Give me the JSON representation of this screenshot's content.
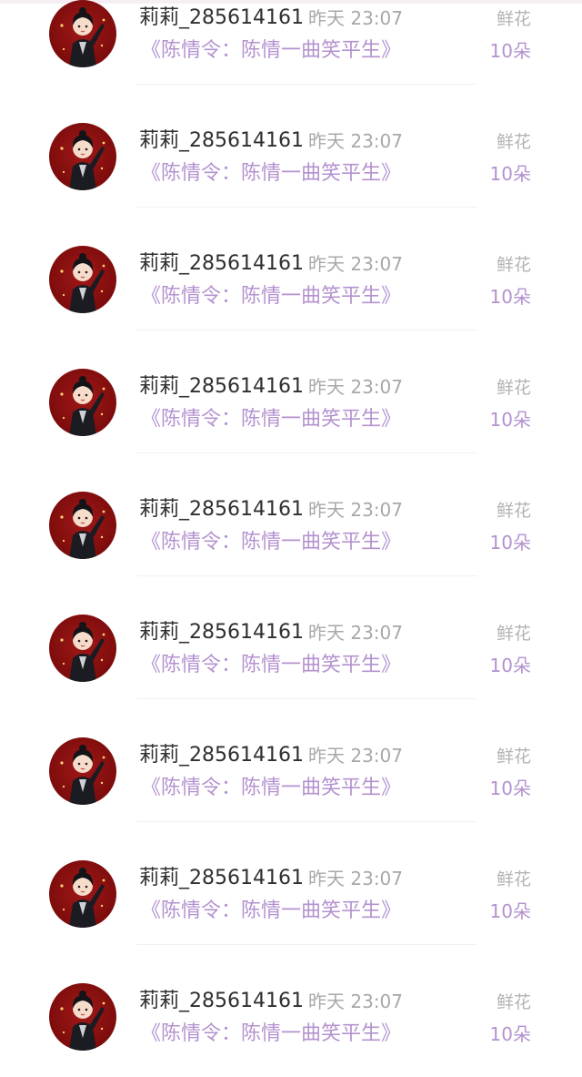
{
  "gift_list": {
    "items": [
      {
        "user": "莉莉_285614161",
        "time": "昨天 23:07",
        "book": "《陈情令：陈情一曲笑平生》",
        "gift_type": "鲜花",
        "gift_count": "10朵",
        "avatar_icon": "user-avatar-icon"
      },
      {
        "user": "莉莉_285614161",
        "time": "昨天 23:07",
        "book": "《陈情令：陈情一曲笑平生》",
        "gift_type": "鲜花",
        "gift_count": "10朵",
        "avatar_icon": "user-avatar-icon"
      },
      {
        "user": "莉莉_285614161",
        "time": "昨天 23:07",
        "book": "《陈情令：陈情一曲笑平生》",
        "gift_type": "鲜花",
        "gift_count": "10朵",
        "avatar_icon": "user-avatar-icon"
      },
      {
        "user": "莉莉_285614161",
        "time": "昨天 23:07",
        "book": "《陈情令：陈情一曲笑平生》",
        "gift_type": "鲜花",
        "gift_count": "10朵",
        "avatar_icon": "user-avatar-icon"
      },
      {
        "user": "莉莉_285614161",
        "time": "昨天 23:07",
        "book": "《陈情令：陈情一曲笑平生》",
        "gift_type": "鲜花",
        "gift_count": "10朵",
        "avatar_icon": "user-avatar-icon"
      },
      {
        "user": "莉莉_285614161",
        "time": "昨天 23:07",
        "book": "《陈情令：陈情一曲笑平生》",
        "gift_type": "鲜花",
        "gift_count": "10朵",
        "avatar_icon": "user-avatar-icon"
      },
      {
        "user": "莉莉_285614161",
        "time": "昨天 23:07",
        "book": "《陈情令：陈情一曲笑平生》",
        "gift_type": "鲜花",
        "gift_count": "10朵",
        "avatar_icon": "user-avatar-icon"
      },
      {
        "user": "莉莉_285614161",
        "time": "昨天 23:07",
        "book": "《陈情令：陈情一曲笑平生》",
        "gift_type": "鲜花",
        "gift_count": "10朵",
        "avatar_icon": "user-avatar-icon"
      },
      {
        "user": "莉莉_285614161",
        "time": "昨天 23:07",
        "book": "《陈情令：陈情一曲笑平生》",
        "gift_type": "鲜花",
        "gift_count": "10朵",
        "avatar_icon": "user-avatar-icon"
      }
    ]
  },
  "colors": {
    "accent_purple": "#b492cf",
    "name_text": "#2f2f2f",
    "muted_text": "#a8a8a8",
    "avatar_red": "#8b0f0f"
  }
}
